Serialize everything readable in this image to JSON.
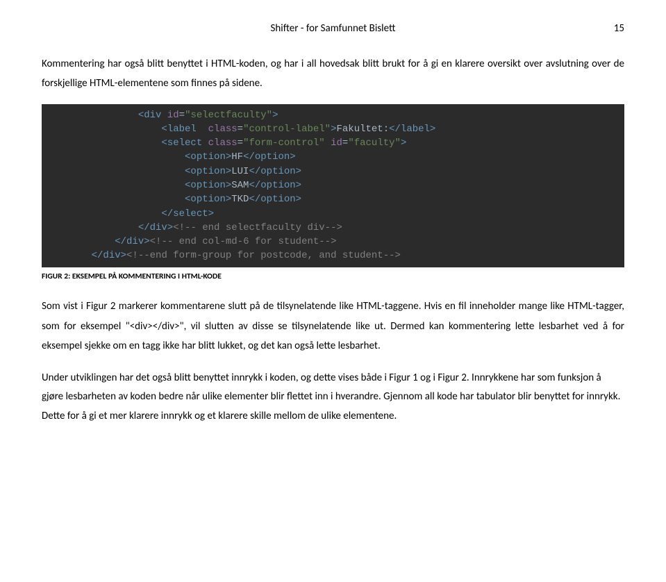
{
  "header": {
    "title": "Shifter - for Samfunnet Bislett",
    "pageNumber": "15"
  },
  "paragraphs": {
    "intro": "Kommentering har også blitt benyttet i HTML-koden, og har i all hovedsak blitt brukt for å gi en klarere oversikt over avslutning over de forskjellige HTML-elementene som finnes på sidene."
  },
  "code": {
    "line1_tag1": "<div ",
    "line1_attr": "id",
    "line1_eq": "=",
    "line1_val": "\"selectfaculty\"",
    "line1_tag2": ">",
    "line2_tag1": "<label  ",
    "line2_attr": "class",
    "line2_eq": "=",
    "line2_val": "\"control-label\"",
    "line2_tag2": ">",
    "line2_txt": "Fakultet:",
    "line2_tag3": "</label>",
    "line3_tag1": "<select ",
    "line3_attr1": "class",
    "line3_eq1": "=",
    "line3_val1": "\"form-control\"",
    "line3_attr2": " id",
    "line3_eq2": "=",
    "line3_val2": "\"faculty\"",
    "line3_tag2": ">",
    "line4_tag1": "<option>",
    "line4_txt": "HF",
    "line4_tag2": "</option>",
    "line5_tag1": "<option>",
    "line5_txt": "LUI",
    "line5_tag2": "</option>",
    "line6_tag1": "<option>",
    "line6_txt": "SAM",
    "line6_tag2": "</option>",
    "line7_tag1": "<option>",
    "line7_txt": "TKD",
    "line7_tag2": "</option>",
    "line8_tag": "</select>",
    "line9_tag": "</div>",
    "line9_comment": "<!-- end selectfaculty div-->",
    "line10_tag": "</div>",
    "line10_comment": "<!-- end col-md-6 for student-->",
    "line11_tag": "</div>",
    "line11_comment": "<!--end form-group for postcode, and student-->"
  },
  "caption": "FIGUR 2: EKSEMPEL PÅ KOMMENTERING I HTML-KODE",
  "body": {
    "p1": "Som vist i Figur 2 markerer kommentarene slutt på de tilsynelatende like HTML-taggene. Hvis en fil inneholder mange like HTML-tagger, som for eksempel \"<div></div>\", vil slutten av disse se tilsynelatende like ut. Dermed kan kommentering lette lesbarhet ved å for eksempel sjekke om en tagg ikke har blitt lukket, og det kan også lette lesbarhet.",
    "p2a": "Under utviklingen har det også blitt benyttet innrykk i koden, og dette vises både i Figur 1 og i Figur 2. Innrykkene har som funksjon å gjøre lesbarheten av koden bedre når ulike elementer blir flettet inn i ",
    "p2b": "hverandre. Gjennom all kode har tabulator blir benyttet for innrykk. Dette for å gi et mer klarere innrykk og et klarere skille mellom de ulike elementene."
  }
}
